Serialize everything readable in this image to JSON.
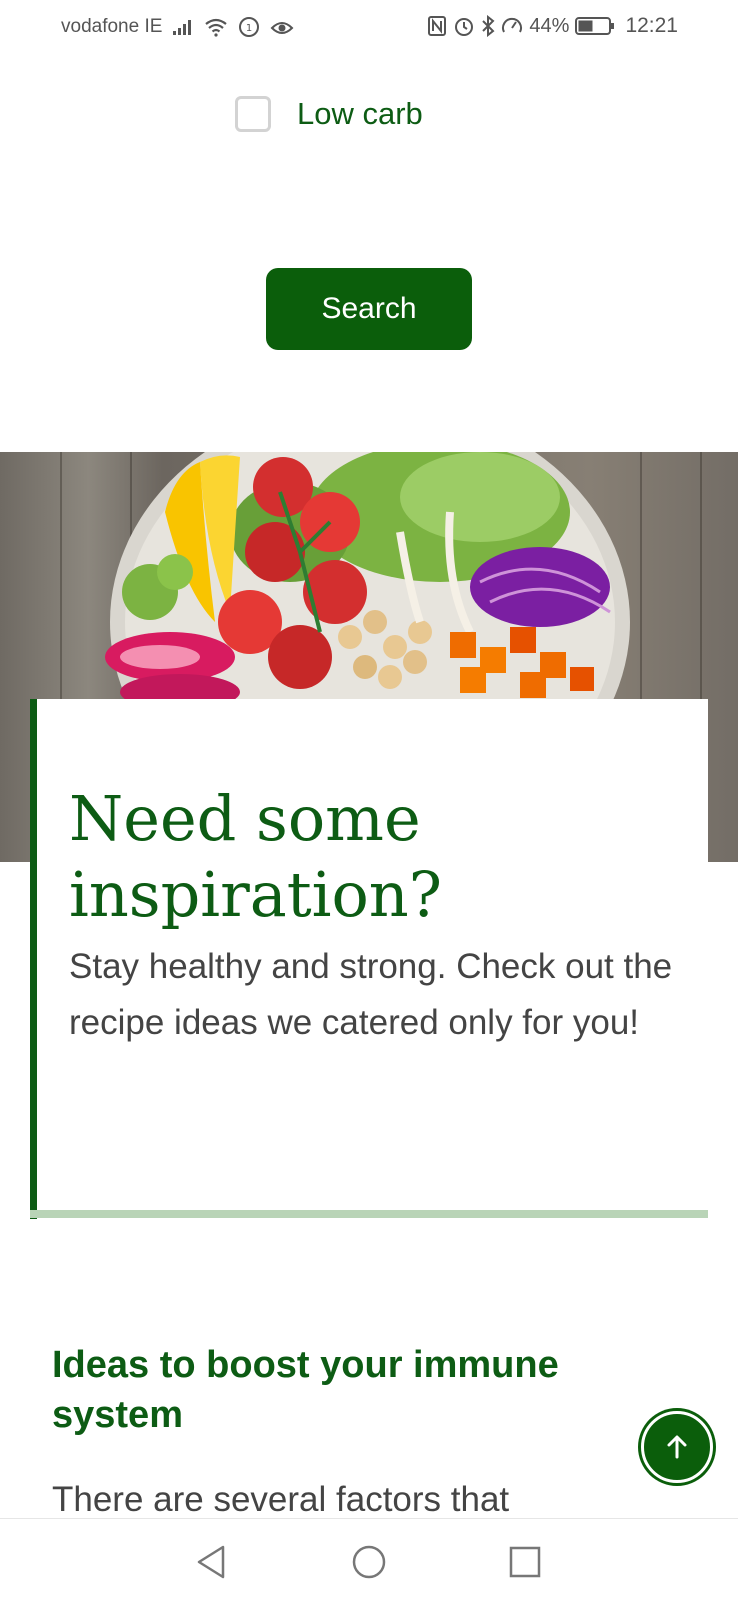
{
  "status_bar": {
    "carrier": "vodafone IE",
    "battery": "44%",
    "time": "12:21",
    "icons": [
      "signal-icon",
      "wifi-icon",
      "data-saver-icon",
      "eye-comfort-icon",
      "nfc-icon",
      "alarm-icon",
      "bluetooth-icon",
      "speed-icon",
      "battery-icon"
    ]
  },
  "filters": {
    "low_carb_label": "Low carb",
    "low_carb_checked": false
  },
  "search": {
    "label": "Search"
  },
  "hero": {
    "image": "salad-bowl-photo"
  },
  "inspiration": {
    "title": "Need some inspiration?",
    "text": "Stay healthy and strong. Check out the recipe ideas we catered only for you!"
  },
  "ideas": {
    "title": "Ideas to boost your immune system",
    "text": "There are several factors that"
  },
  "colors": {
    "primary": "#0b5e0b",
    "heading": "#0d5c14",
    "accent_line": "#b9d4b7",
    "body_text": "#444444"
  },
  "navigation": {
    "icons": [
      "back-icon",
      "home-icon",
      "recents-icon"
    ]
  }
}
